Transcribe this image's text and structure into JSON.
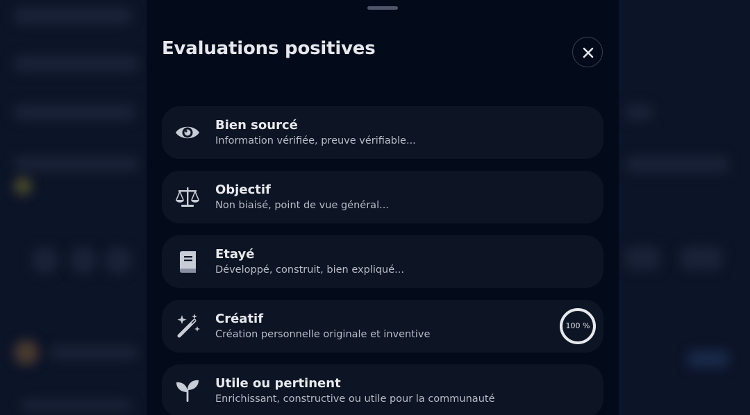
{
  "sheet": {
    "title": "Evaluations positives",
    "close_icon": "close-icon"
  },
  "items": [
    {
      "label": "Bien sourcé",
      "description": "Information vérifiée, preuve vérifiable...",
      "icon": "eye-icon"
    },
    {
      "label": "Objectif",
      "description": "Non biaisé, point de vue général...",
      "icon": "scale-icon"
    },
    {
      "label": "Etayé",
      "description": "Développé, construit, bien expliqué...",
      "icon": "book-icon"
    },
    {
      "label": "Créatif",
      "description": "Création personnelle originale et inventive",
      "icon": "magic-wand-icon",
      "progress_text": "100 %",
      "progress_fraction": 1.0
    },
    {
      "label": "Utile ou pertinent",
      "description": "Enrichissant, constructive ou utile pour la communauté",
      "icon": "sprout-icon"
    }
  ],
  "colors": {
    "sheet_background": "#030a1a",
    "card_background": "#0d1424",
    "text_primary": "#e8eaef",
    "text_secondary": "#b9bdc8",
    "icon_color": "#c8ccd6",
    "progress_ring": "#e6e8ee"
  }
}
